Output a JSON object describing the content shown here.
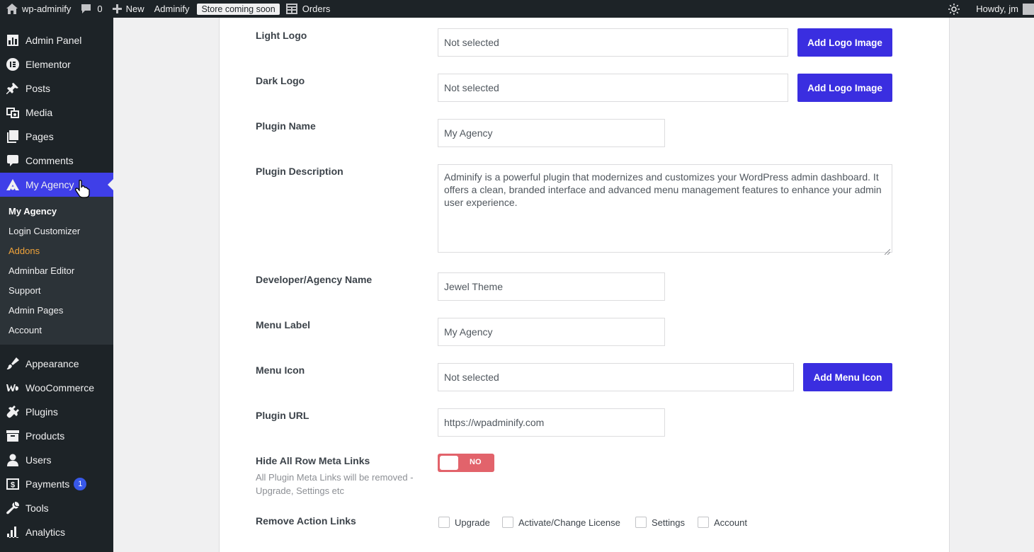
{
  "adminbar": {
    "site_name": "wp-adminify",
    "comments_count": "0",
    "new_label": "New",
    "adminify_label": "Adminify",
    "store_badge": "Store coming soon",
    "orders_label": "Orders",
    "howdy": "Howdy, jm"
  },
  "sidebar": {
    "top_items": [
      {
        "label": "Admin Panel",
        "icon": "dashboard-icon"
      },
      {
        "label": "Elementor",
        "icon": "elementor-icon"
      },
      {
        "label": "Posts",
        "icon": "pin-icon"
      },
      {
        "label": "Media",
        "icon": "media-icon"
      },
      {
        "label": "Pages",
        "icon": "pages-icon"
      },
      {
        "label": "Comments",
        "icon": "comment-icon"
      }
    ],
    "active_item": {
      "label": "My Agency",
      "icon": "agency-icon"
    },
    "submenu": [
      {
        "label": "My Agency"
      },
      {
        "label": "Login Customizer"
      },
      {
        "label": "Addons"
      },
      {
        "label": "Adminbar Editor"
      },
      {
        "label": "Support"
      },
      {
        "label": "Admin Pages"
      },
      {
        "label": "Account"
      }
    ],
    "bottom_items": [
      {
        "label": "Appearance",
        "icon": "brush-icon"
      },
      {
        "label": "WooCommerce",
        "icon": "woo-icon"
      },
      {
        "label": "Plugins",
        "icon": "plugin-icon"
      },
      {
        "label": "Products",
        "icon": "archive-icon"
      },
      {
        "label": "Users",
        "icon": "user-icon"
      },
      {
        "label": "Payments",
        "icon": "dollar-icon",
        "badge": "1"
      },
      {
        "label": "Tools",
        "icon": "wrench-icon"
      },
      {
        "label": "Analytics",
        "icon": "chart-icon"
      }
    ]
  },
  "form": {
    "light_logo": {
      "label": "Light Logo",
      "value": "Not selected",
      "button": "Add Logo Image"
    },
    "dark_logo": {
      "label": "Dark Logo",
      "value": "Not selected",
      "button": "Add Logo Image"
    },
    "plugin_name": {
      "label": "Plugin Name",
      "value": "My Agency"
    },
    "plugin_description": {
      "label": "Plugin Description",
      "value": "Adminify is a powerful plugin that modernizes and customizes your WordPress admin dashboard. It offers a clean, branded interface and advanced menu management features to enhance your admin user experience."
    },
    "developer_name": {
      "label": "Developer/Agency Name",
      "value": "Jewel Theme"
    },
    "menu_label": {
      "label": "Menu Label",
      "value": "My Agency"
    },
    "menu_icon": {
      "label": "Menu Icon",
      "value": "Not selected",
      "button": "Add Menu Icon"
    },
    "plugin_url": {
      "label": "Plugin URL",
      "value": "https://wpadminify.com"
    },
    "hide_meta_links": {
      "label": "Hide All Row Meta Links",
      "description": "All Plugin Meta Links will be removed - Upgrade, Settings etc",
      "toggle_text": "NO",
      "enabled": false
    },
    "remove_action_links": {
      "label": "Remove Action Links",
      "options": [
        {
          "label": "Upgrade",
          "checked": false
        },
        {
          "label": "Activate/Change License",
          "checked": false
        },
        {
          "label": "Settings",
          "checked": false
        },
        {
          "label": "Account",
          "checked": false
        }
      ]
    }
  },
  "colors": {
    "accent": "#3a2ee0",
    "menu_active": "#3f3fe8",
    "toggle_off": "#e2636b",
    "addons_highlight": "#f0a33a"
  }
}
